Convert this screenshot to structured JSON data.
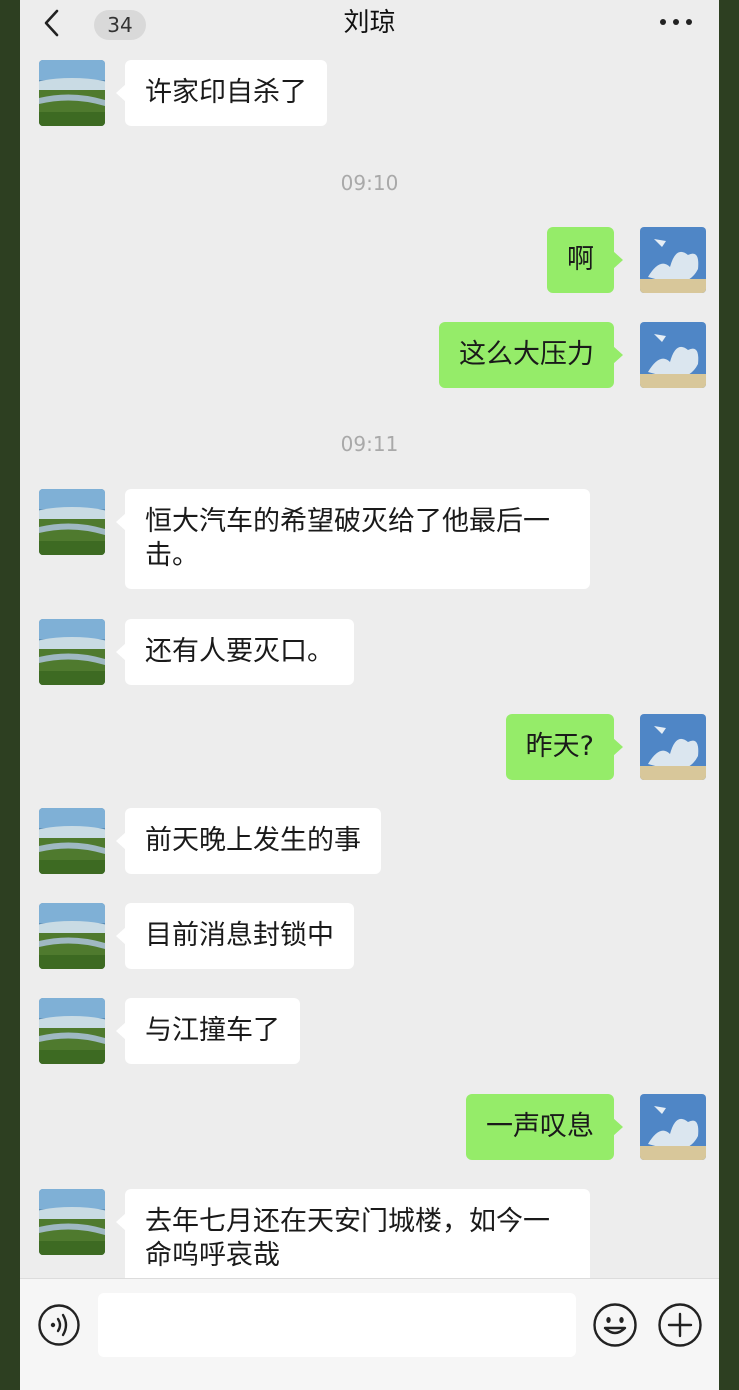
{
  "header": {
    "unread_count": "34",
    "title": "刘琼"
  },
  "messages": [
    {
      "type": "in",
      "text": "许家印自杀了"
    },
    {
      "type": "time",
      "text": "09:10"
    },
    {
      "type": "out",
      "text": "啊"
    },
    {
      "type": "out",
      "text": "这么大压力"
    },
    {
      "type": "time",
      "text": "09:11"
    },
    {
      "type": "in",
      "text": "恒大汽车的希望破灭给了他最后一击。"
    },
    {
      "type": "in",
      "text": "还有人要灭口。"
    },
    {
      "type": "out",
      "text": "昨天?"
    },
    {
      "type": "in",
      "text": "前天晚上发生的事"
    },
    {
      "type": "in",
      "text": "目前消息封锁中"
    },
    {
      "type": "in",
      "text": "与江撞车了"
    },
    {
      "type": "out",
      "text": "一声叹息"
    },
    {
      "type": "in",
      "text": "去年七月还在天安门城楼，如今一命呜呼哀哉"
    }
  ],
  "input": {
    "value": "",
    "placeholder": ""
  },
  "icons": {
    "back": "chevron-left-icon",
    "more": "more-dots-icon",
    "voice": "voice-icon",
    "emoji": "emoji-icon",
    "plus": "plus-icon"
  },
  "colors": {
    "screen_bg": "#ededed",
    "outer_border": "#2d3f21",
    "incoming_bubble": "#ffffff",
    "outgoing_bubble": "#95ec69",
    "timestamp_text": "#a9a9a9"
  }
}
